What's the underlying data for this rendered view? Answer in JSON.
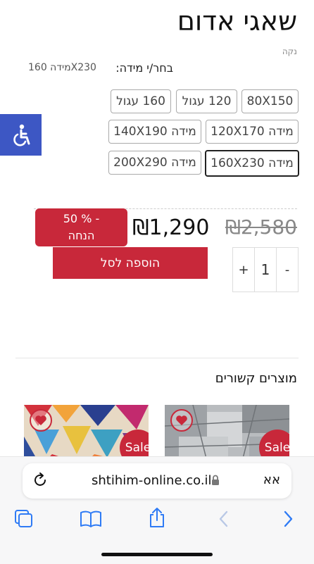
{
  "product": {
    "title": "שאגי אדום",
    "clear_link": "נקה",
    "size_label": "בחר/י מידה:",
    "size_selected": "מידה 160X230"
  },
  "sizes": [
    {
      "label": "80X150"
    },
    {
      "label": "120 עגול"
    },
    {
      "label": "160 עגול"
    },
    {
      "label": "מידה 120X170"
    },
    {
      "label": "מידה 140X190"
    },
    {
      "label": "מידה 160X230",
      "selected": true
    },
    {
      "label": "מידה 200X290"
    }
  ],
  "price": {
    "old": "₪2,580",
    "new": "₪1,290",
    "discount_line1": "50 % -",
    "discount_line2": "הנחה"
  },
  "cart": {
    "add_label": "הוספה לסל",
    "qty_plus": "+",
    "qty_value": "1",
    "qty_minus": "-"
  },
  "related": {
    "title": "מוצרים קשורים",
    "sale_label": "Sale"
  },
  "browser": {
    "url": "shtihim-online.co.il",
    "aa_label": "אא"
  },
  "colors": {
    "accent": "#c8283a",
    "accessibility": "#3d57c4",
    "ios_blue": "#2f7bf5"
  },
  "icons": {
    "accessibility": "wheelchair-icon",
    "reload": "reload-icon",
    "lock": "lock-icon",
    "tabs": "tabs-icon",
    "bookmarks": "book-icon",
    "share": "share-icon",
    "back": "chevron-left-icon",
    "forward": "chevron-right-icon"
  }
}
